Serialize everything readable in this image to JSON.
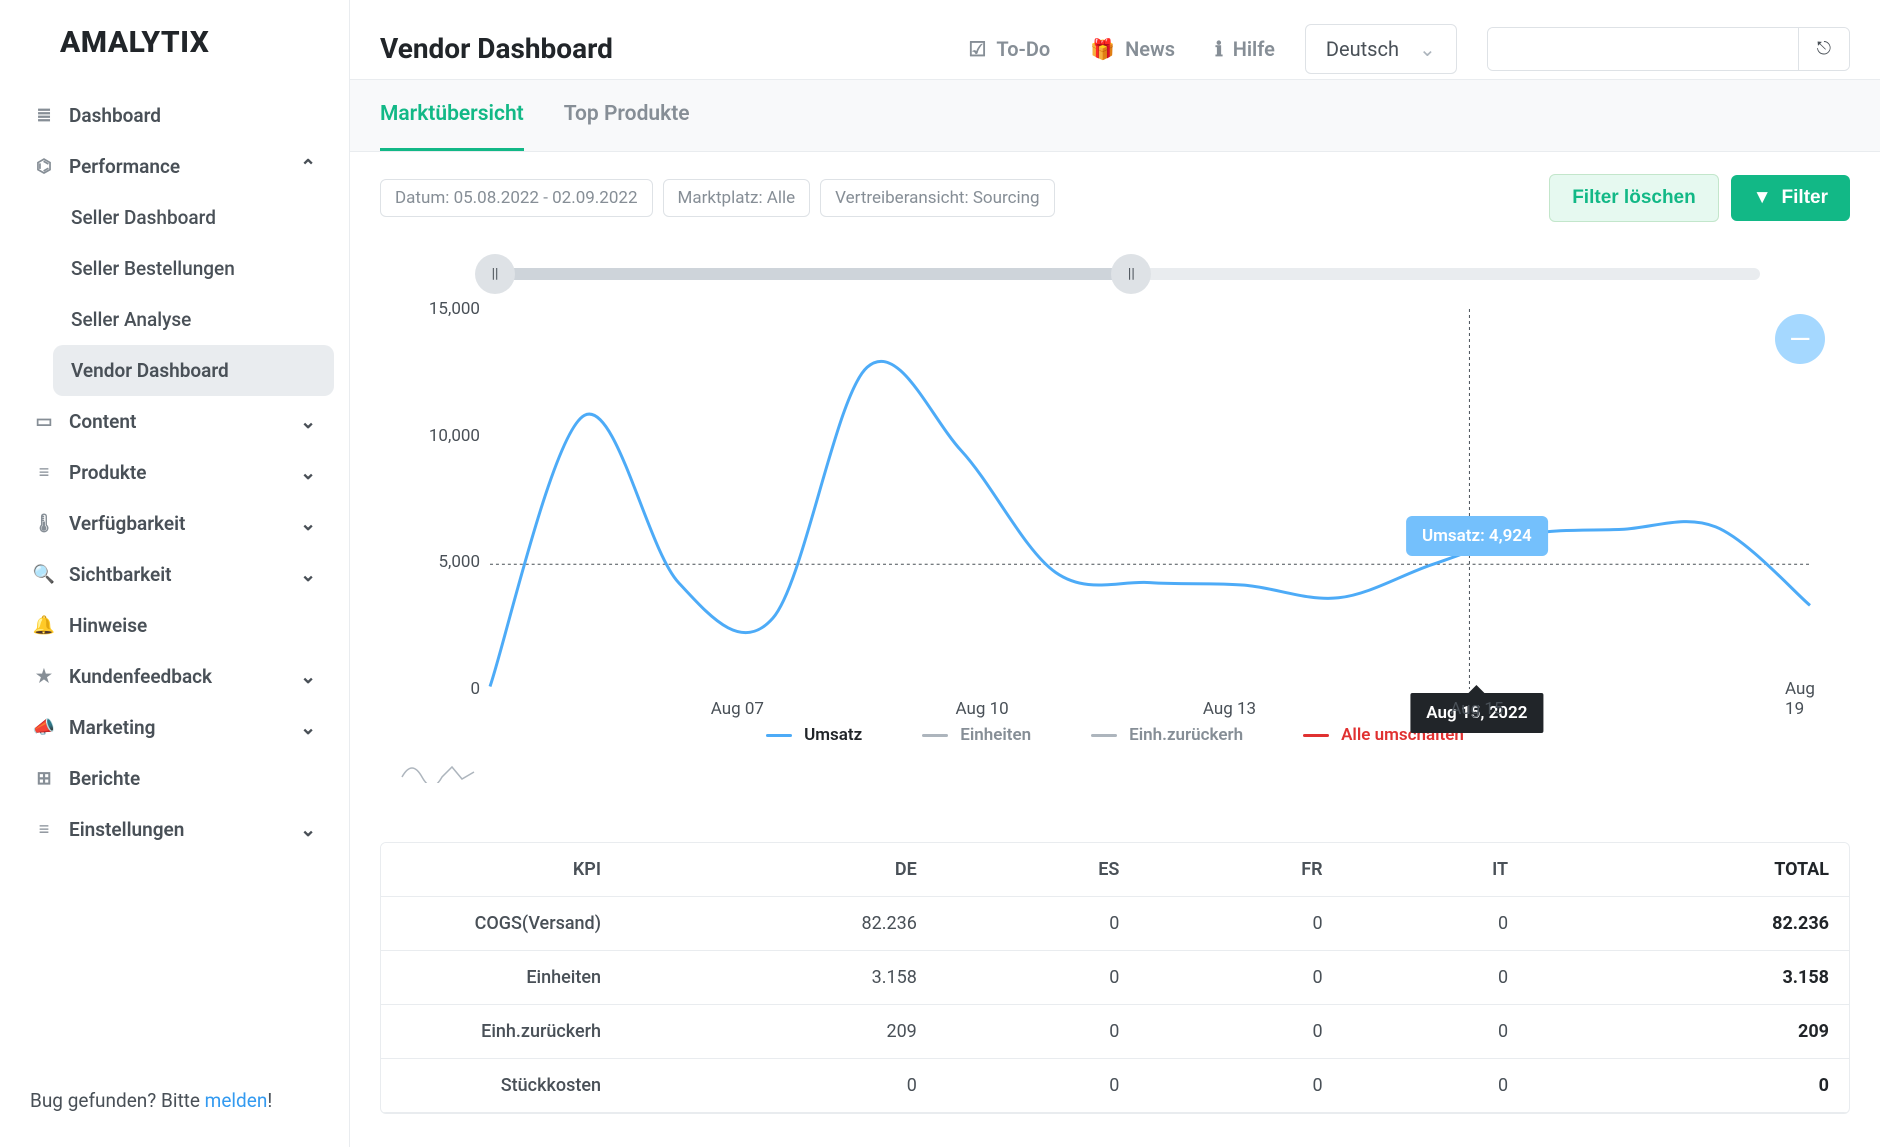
{
  "brand": "AMALYTIX",
  "sidebar": {
    "items": [
      {
        "label": "Dashboard",
        "icon": "≣",
        "expandable": false
      },
      {
        "label": "Performance",
        "icon": "⌬",
        "expandable": true,
        "open": true,
        "sub": [
          {
            "label": "Seller Dashboard"
          },
          {
            "label": "Seller Bestellungen"
          },
          {
            "label": "Seller Analyse"
          },
          {
            "label": "Vendor Dashboard",
            "active": true
          }
        ]
      },
      {
        "label": "Content",
        "icon": "▭",
        "expandable": true
      },
      {
        "label": "Produkte",
        "icon": "≡",
        "expandable": true
      },
      {
        "label": "Verfügbarkeit",
        "icon": "🌡",
        "expandable": true
      },
      {
        "label": "Sichtbarkeit",
        "icon": "🔍",
        "expandable": true
      },
      {
        "label": "Hinweise",
        "icon": "🔔",
        "expandable": false
      },
      {
        "label": "Kundenfeedback",
        "icon": "★",
        "expandable": true
      },
      {
        "label": "Marketing",
        "icon": "📣",
        "expandable": true
      },
      {
        "label": "Berichte",
        "icon": "⊞",
        "expandable": false
      },
      {
        "label": "Einstellungen",
        "icon": "≡",
        "expandable": true
      }
    ],
    "bug_text_pre": "Bug gefunden? Bitte ",
    "bug_link": "melden",
    "bug_text_post": "!"
  },
  "header": {
    "title": "Vendor Dashboard",
    "links": [
      {
        "label": "To-Do",
        "icon": "☑"
      },
      {
        "label": "News",
        "icon": "🎁"
      },
      {
        "label": "Hilfe",
        "icon": "ℹ"
      }
    ],
    "language": "Deutsch"
  },
  "tabs": [
    {
      "label": "Marktübersicht",
      "active": true
    },
    {
      "label": "Top Produkte",
      "active": false
    }
  ],
  "filters": {
    "chips": [
      "Datum: 05.08.2022 - 02.09.2022",
      "Marktplatz: Alle",
      "Vertreiberansicht: Sourcing"
    ],
    "clear": "Filter löschen",
    "apply": "Filter"
  },
  "chart_data": {
    "type": "line",
    "title": "",
    "xlabel": "",
    "ylabel": "",
    "ylim": [
      0,
      15000
    ],
    "y_ticks": [
      "0",
      "5,000",
      "10,000",
      "15,000"
    ],
    "x_ticks": [
      "Aug 07",
      "Aug 10",
      "Aug 13",
      "Aug 15",
      "Aug 19"
    ],
    "x_tick_positions": [
      0.186,
      0.37,
      0.556,
      0.742,
      0.99
    ],
    "series": [
      {
        "name": "Umsatz",
        "visible": true,
        "color": "#4dabf7",
        "x": [
          "Aug 05",
          "Aug 06",
          "Aug 07",
          "Aug 08",
          "Aug 09",
          "Aug 10",
          "Aug 11",
          "Aug 12",
          "Aug 13",
          "Aug 14",
          "Aug 15",
          "Aug 16",
          "Aug 17",
          "Aug 18",
          "Aug 19"
        ],
        "values": [
          100,
          10800,
          4200,
          2800,
          12700,
          9400,
          4600,
          4200,
          4100,
          3600,
          4924,
          6100,
          6300,
          6400,
          3300
        ]
      },
      {
        "name": "Einheiten",
        "visible": false,
        "color": "#adb5bd",
        "values": []
      },
      {
        "name": "Einh.zurückerh",
        "visible": false,
        "color": "#adb5bd",
        "values": []
      }
    ],
    "toggle_all": "Alle umschalten",
    "tooltip": {
      "value_label": "Umsatz: 4,924",
      "date_label": "Aug 15, 2022",
      "x_fraction": 0.742,
      "y_value": 4924
    }
  },
  "table": {
    "headers": [
      "KPI",
      "DE",
      "ES",
      "FR",
      "IT",
      "TOTAL"
    ],
    "rows": [
      [
        "COGS(Versand)",
        "82.236",
        "0",
        "0",
        "0",
        "82.236"
      ],
      [
        "Einheiten",
        "3.158",
        "0",
        "0",
        "0",
        "3.158"
      ],
      [
        "Einh.zurückerh",
        "209",
        "0",
        "0",
        "0",
        "209"
      ],
      [
        "Stückkosten",
        "0",
        "0",
        "0",
        "0",
        "0"
      ]
    ]
  }
}
